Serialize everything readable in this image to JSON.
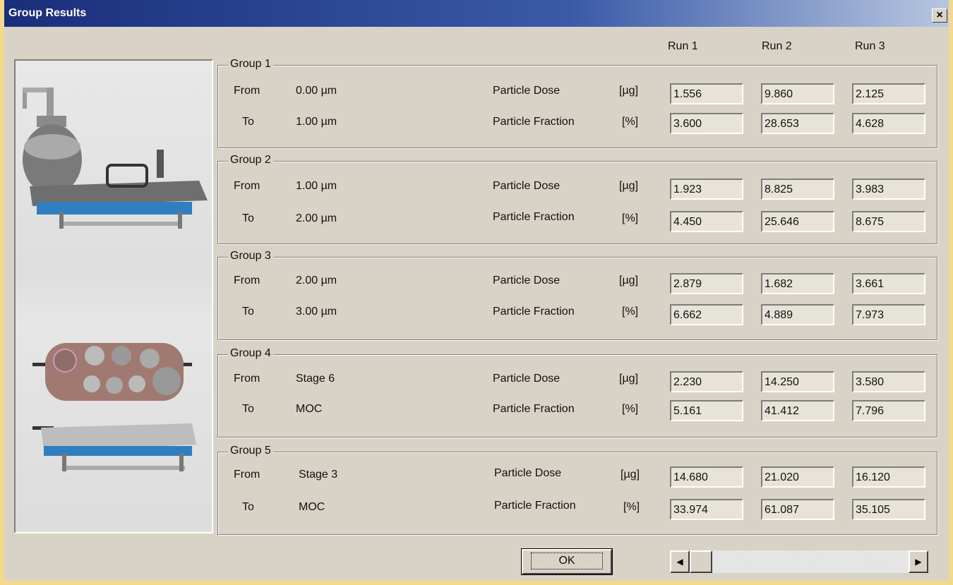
{
  "window": {
    "title": "Group Results",
    "close_label": "×"
  },
  "headers": {
    "run1": "Run 1",
    "run2": "Run 2",
    "run3": "Run 3"
  },
  "groups": [
    {
      "title": "Group 1",
      "from_label": "From",
      "from": "0.00 µm",
      "to_label": "To",
      "to": "1.00 µm",
      "dose_label": "Particle Dose",
      "dose_unit": "[µg]",
      "fraction_label": "Particle Fraction",
      "fraction_unit": "[%]",
      "dose": [
        "1.556",
        "9.860",
        "2.125"
      ],
      "fraction": [
        "3.600",
        "28.653",
        "4.628"
      ]
    },
    {
      "title": "Group 2",
      "from_label": "From",
      "from": "1.00 µm",
      "to_label": "To",
      "to": "2.00 µm",
      "dose_label": "Particle Dose",
      "dose_unit": "[µg]",
      "fraction_label": "Particle Fraction",
      "fraction_unit": "[%]",
      "dose": [
        "1.923",
        "8.825",
        "3.983"
      ],
      "fraction": [
        "4.450",
        "25.646",
        "8.675"
      ]
    },
    {
      "title": "Group 3",
      "from_label": "From",
      "from": "2.00 µm",
      "to_label": "To",
      "to": "3.00 µm",
      "dose_label": "Particle Dose",
      "dose_unit": "[µg]",
      "fraction_label": "Particle Fraction",
      "fraction_unit": "[%]",
      "dose": [
        "2.879",
        "1.682",
        "3.661"
      ],
      "fraction": [
        "6.662",
        "4.889",
        "7.973"
      ]
    },
    {
      "title": "Group 4",
      "from_label": "From",
      "from": "Stage 6",
      "to_label": "To",
      "to": "MOC",
      "dose_label": "Particle Dose",
      "dose_unit": "[µg]",
      "fraction_label": "Particle Fraction",
      "fraction_unit": "[%]",
      "dose": [
        "2.230",
        "14.250",
        "3.580"
      ],
      "fraction": [
        "5.161",
        "41.412",
        "7.796"
      ]
    },
    {
      "title": "Group 5",
      "from_label": "From",
      "from": "Stage 3",
      "to_label": "To",
      "to": "MOC",
      "dose_label": "Particle Dose",
      "dose_unit": "[µg]",
      "fraction_label": "Particle Fraction",
      "fraction_unit": "[%]",
      "dose": [
        "14.680",
        "21.020",
        "16.120"
      ],
      "fraction": [
        "33.974",
        "61.087",
        "35.105"
      ]
    }
  ],
  "buttons": {
    "ok": "OK"
  },
  "scrollbar": {
    "left_arrow": "◀",
    "right_arrow": "▶"
  },
  "icons": {
    "close": "close-icon",
    "impactor_top": "cascade-impactor-image",
    "impactor_bottom": "impactor-cups-image"
  }
}
